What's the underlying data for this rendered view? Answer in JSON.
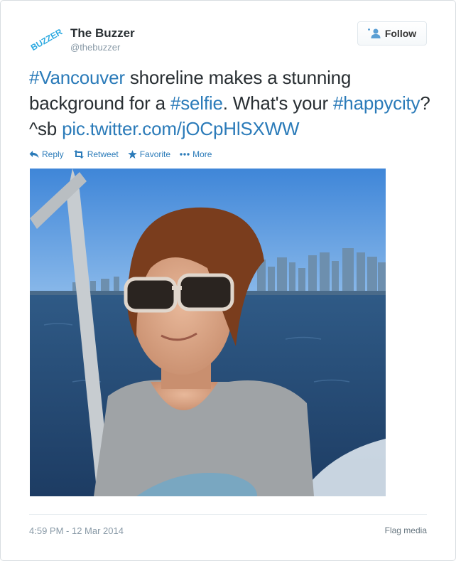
{
  "user": {
    "name": "The Buzzer",
    "handle": "@thebuzzer",
    "avatar_text": "BUZZER",
    "avatar_color": "#29a8e0"
  },
  "follow_button": {
    "label": "Follow",
    "icon": "follow-person-plus-icon"
  },
  "tweet": {
    "segments": [
      {
        "text": "#Vancouver",
        "type": "link"
      },
      {
        "text": " shoreline makes a stunning background for a ",
        "type": "text"
      },
      {
        "text": "#selfie",
        "type": "link"
      },
      {
        "text": ". What's your ",
        "type": "text"
      },
      {
        "text": "#happycity",
        "type": "link"
      },
      {
        "text": "? ^sb ",
        "type": "text"
      },
      {
        "text": "pic.twitter.com/jOCpHlSXWW",
        "type": "link"
      }
    ]
  },
  "actions": [
    {
      "label": "Reply",
      "icon": "reply-icon"
    },
    {
      "label": "Retweet",
      "icon": "retweet-icon"
    },
    {
      "label": "Favorite",
      "icon": "star-icon"
    },
    {
      "label": "More",
      "icon": "more-dots-icon"
    }
  ],
  "photo": {
    "icon": "photo-selfie-vancouver-shoreline"
  },
  "footer": {
    "timestamp": "4:59 PM - 12 Mar 2014",
    "flag_label": "Flag media"
  },
  "colors": {
    "link": "#2b7bb9",
    "text": "#292f33",
    "muted": "#8899a6"
  }
}
